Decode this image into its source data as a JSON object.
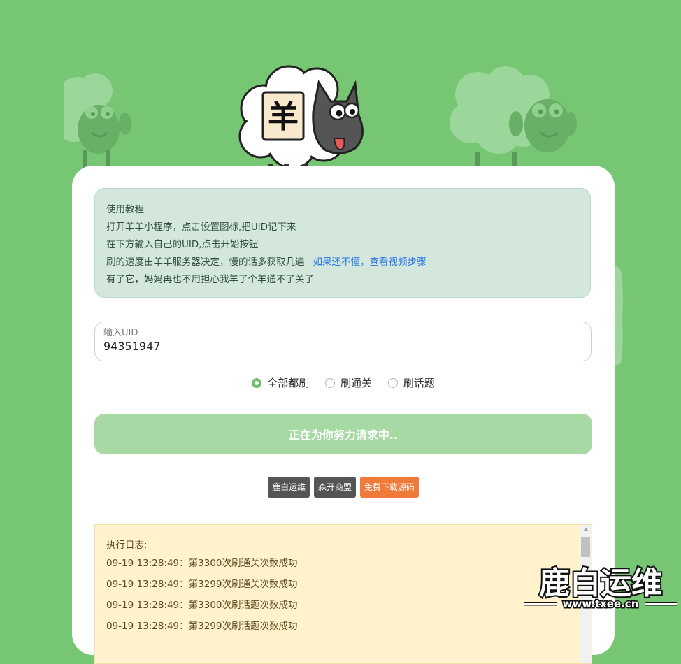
{
  "tutorial": {
    "lines": [
      "使用教程",
      "打开羊羊小程序，点击设置图标,把UID记下来",
      "在下方输入自己的UID,点击开始按钮",
      "刷的速度由羊羊服务器决定，慢的话多获取几遍",
      "有了它，妈妈再也不用担心我羊了个羊通不了关了"
    ],
    "video_link": "如果还不懂，查看视频步骤"
  },
  "uid_input": {
    "label": "输入UID",
    "value": "94351947"
  },
  "modes": [
    {
      "label": "全部都刷",
      "checked": true
    },
    {
      "label": "刷通关",
      "checked": false
    },
    {
      "label": "刷话题",
      "checked": false
    }
  ],
  "submit_button": "正在为你努力请求中..",
  "tags": [
    "鹿白运维",
    "森开商盟",
    "免费下载源码"
  ],
  "log": {
    "title": "执行日志:",
    "entries": [
      "09-19 13:28:49：第3300次刷通关次数成功",
      "09-19 13:28:49：第3299次刷通关次数成功",
      "09-19 13:28:49：第3300次刷话题次数成功",
      "09-19 13:28:49：第3299次刷话题次数成功"
    ]
  },
  "mascot": {
    "glyph": "羊"
  },
  "watermark": {
    "title": "鹿白运维",
    "url": "www.txee.cn"
  },
  "colors": {
    "background": "#77c674",
    "accent": "#6fbf6e",
    "link": "#2b74e8",
    "orange": "#f07a3a"
  }
}
